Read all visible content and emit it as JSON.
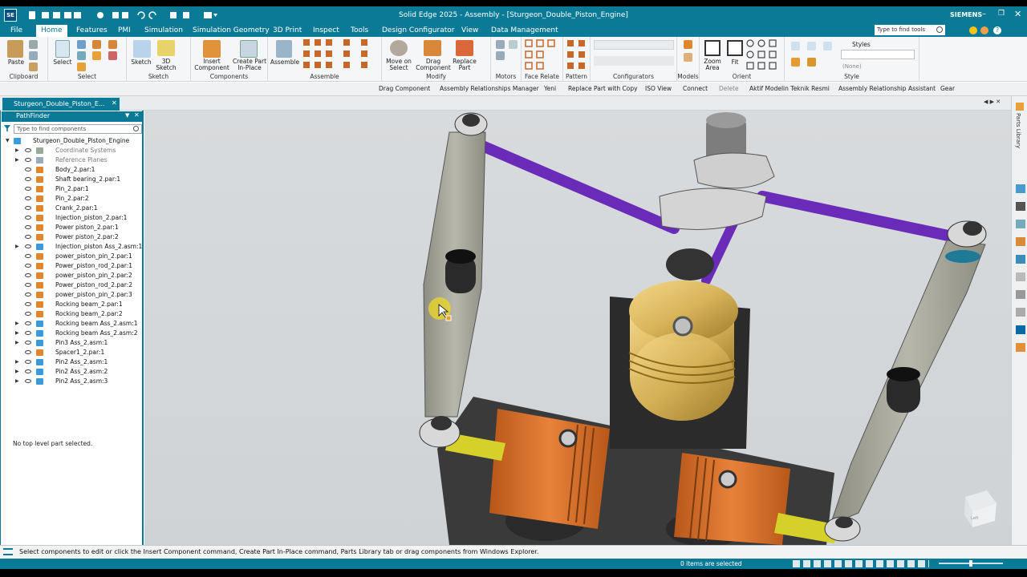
{
  "app": {
    "title": "Solid Edge 2025 - Assembly - [Sturgeon_Double_Piston_Engine]",
    "logo": "SE",
    "brand": "SIEMENS",
    "search_tools_placeholder": "Type to find tools"
  },
  "menu": [
    "File",
    "Home",
    "Features",
    "PMI",
    "Simulation",
    "Simulation Geometry",
    "3D Print",
    "Inspect",
    "Tools",
    "Design Configurator",
    "View",
    "Data Management"
  ],
  "ribbon": {
    "groups": [
      "Clipboard",
      "Select",
      "Sketch",
      "Components",
      "Assemble",
      "Modify",
      "Motors",
      "Face Relate",
      "Pattern",
      "Configurators",
      "Models",
      "Orient",
      "Style"
    ],
    "buttons": {
      "paste": "Paste",
      "select": "Select",
      "sketch": "Sketch",
      "sketch3d": "3D\nSketch",
      "insert_component": "Insert\nComponent",
      "create_part": "Create Part\nIn-Place",
      "assemble": "Assemble",
      "move_on_select": "Move on\nSelect",
      "drag_component": "Drag\nComponent",
      "replace_part": "Replace\nPart",
      "zoom_area": "Zoom\nArea",
      "fit": "Fit",
      "styles": "Styles",
      "style_none": "(None)"
    }
  },
  "command_bar": [
    "Drag Component",
    "Assembly Relationships Manager",
    "Yeni",
    "Replace Part with Copy",
    "ISO View",
    "Connect",
    "Delete",
    "Aktif Modelin Teknik Resmi",
    "Assembly Relationship Assistant",
    "Gear"
  ],
  "doc_tab": "Sturgeon_Double_Piston_E...",
  "pathfinder": {
    "title": "PathFinder",
    "search_placeholder": "Type to find components",
    "root": "Sturgeon_Double_Piston_Engine",
    "items": [
      {
        "label": "Coordinate Systems",
        "kind": "sys",
        "expand": true,
        "dim": true
      },
      {
        "label": "Reference Planes",
        "kind": "plane",
        "expand": true,
        "dim": true
      },
      {
        "label": "Body_2.par:1",
        "kind": "part",
        "expand": false
      },
      {
        "label": "Shaft bearing_2.par:1",
        "kind": "part",
        "expand": false
      },
      {
        "label": "Pin_2.par:1",
        "kind": "part",
        "expand": false
      },
      {
        "label": "Pin_2.par:2",
        "kind": "part",
        "expand": false
      },
      {
        "label": "Crank_2.par:1",
        "kind": "part",
        "expand": false
      },
      {
        "label": "Injection_piston_2.par:1",
        "kind": "part",
        "expand": false
      },
      {
        "label": "Power piston_2.par:1",
        "kind": "part",
        "expand": false
      },
      {
        "label": "Power piston_2.par:2",
        "kind": "part",
        "expand": false
      },
      {
        "label": "Injection_piston Ass_2.asm:1",
        "kind": "asm",
        "expand": true
      },
      {
        "label": "power_piston_pin_2.par:1",
        "kind": "part",
        "expand": false
      },
      {
        "label": "Power_piston_rod_2.par:1",
        "kind": "part",
        "expand": false
      },
      {
        "label": "power_piston_pin_2.par:2",
        "kind": "part",
        "expand": false
      },
      {
        "label": "Power_piston_rod_2.par:2",
        "kind": "part",
        "expand": false
      },
      {
        "label": "power_piston_pin_2.par:3",
        "kind": "part",
        "expand": false
      },
      {
        "label": "Rocking beam_2.par:1",
        "kind": "part",
        "expand": false
      },
      {
        "label": "Rocking beam_2.par:2",
        "kind": "part",
        "expand": false
      },
      {
        "label": "Rocking beam Ass_2.asm:1",
        "kind": "asm",
        "expand": true
      },
      {
        "label": "Rocking beam Ass_2.asm:2",
        "kind": "asm",
        "expand": true
      },
      {
        "label": "Pin3 Ass_2.asm:1",
        "kind": "asm",
        "expand": true
      },
      {
        "label": "Spacer1_2.par:1",
        "kind": "part",
        "expand": false
      },
      {
        "label": "Pin2 Ass_2.asm:1",
        "kind": "asm",
        "expand": true
      },
      {
        "label": "Pin2 Ass_2.asm:2",
        "kind": "asm",
        "expand": true
      },
      {
        "label": "Pin2 Ass_2.asm:3",
        "kind": "asm",
        "expand": true
      }
    ],
    "footer": "No top level part selected."
  },
  "right_panel_label": "Parts Library",
  "prompt": "Select components to edit or click the Insert Component command, Create Part In-Place command, Parts Library tab or drag components from Windows Explorer.",
  "status": "0 items are selected",
  "view_cube_label": "Left"
}
